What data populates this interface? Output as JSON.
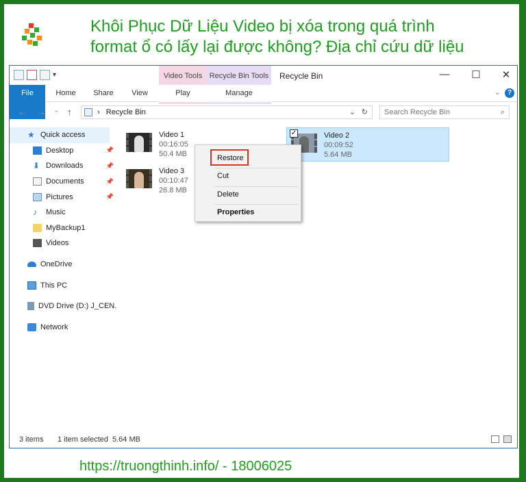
{
  "headline": "Khôi Phục Dữ Liệu Video bị xóa trong quá trình format ổ có lấy lại được không? Địa chỉ cứu dữ liệu",
  "footer": "https://truongthinh.info/ - 18006025",
  "colors": {
    "accent_green": "#1e9e1e",
    "frame": "#1f7a1f",
    "file_tab": "#1979ca",
    "selection": "#cce8ff",
    "highlight_box": "#d9322b"
  },
  "explorer": {
    "title": "Recycle Bin",
    "tool_tabs": {
      "video": "Video Tools",
      "recycle": "Recycle Bin Tools"
    },
    "ribbon_tabs": [
      "File",
      "Home",
      "Share",
      "View",
      "Play",
      "Manage"
    ],
    "window_controls": {
      "minimize": "—",
      "maximize": "☐",
      "close": "✕"
    },
    "address": "Recycle Bin",
    "search_placeholder": "Search Recycle Bin",
    "sidebar": [
      {
        "label": "Quick access",
        "icon": "star-icon"
      },
      {
        "label": "Desktop",
        "icon": "desktop-icon"
      },
      {
        "label": "Downloads",
        "icon": "download-icon"
      },
      {
        "label": "Documents",
        "icon": "document-icon"
      },
      {
        "label": "Pictures",
        "icon": "picture-icon"
      },
      {
        "label": "Music",
        "icon": "music-icon"
      },
      {
        "label": "MyBackup1",
        "icon": "folder-icon"
      },
      {
        "label": "Videos",
        "icon": "video-icon"
      },
      {
        "label": "OneDrive",
        "icon": "cloud-icon"
      },
      {
        "label": "This PC",
        "icon": "pc-icon"
      },
      {
        "label": "DVD Drive (D:) J_CEN.",
        "icon": "dvd-icon"
      },
      {
        "label": "Network",
        "icon": "network-icon"
      }
    ],
    "files": [
      {
        "name": "Video 1",
        "duration": "00:16:05",
        "size": "50.4 MB",
        "selected": false
      },
      {
        "name": "Video 2",
        "duration": "00:09:52",
        "size": "5.64 MB",
        "selected": true
      },
      {
        "name": "Video 3",
        "duration": "00:10:47",
        "size": "26.8 MB",
        "selected": false
      }
    ],
    "context_menu": [
      "Restore",
      "Cut",
      "Delete",
      "Properties"
    ],
    "status": {
      "count": "3 items",
      "selected": "1 item selected",
      "size": "5.64 MB"
    }
  }
}
